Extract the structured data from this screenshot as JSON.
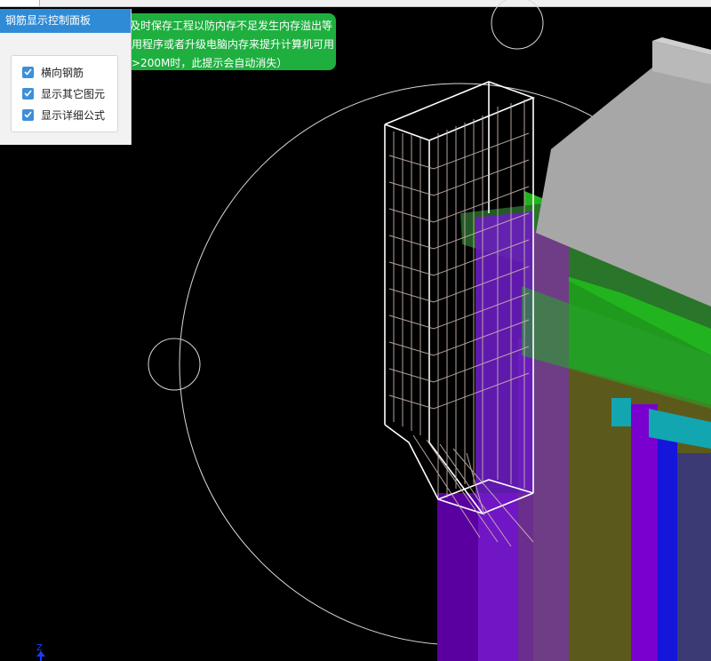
{
  "panel": {
    "title": "钢筋显示控制面板",
    "options": [
      {
        "label": "横向钢筋",
        "checked": true
      },
      {
        "label": "显示其它图元",
        "checked": true
      },
      {
        "label": "显示详细公式",
        "checked": true
      }
    ]
  },
  "toast": {
    "line1": "及时保存工程以防内存不足发生内存溢出等",
    "line2": "用程序或者升级电脑内存来提升计算机可用",
    "line3": ">200M时，此提示会自动消失）"
  },
  "axis": {
    "label": "Z"
  },
  "colors": {
    "panel_header": "#2f8bd6",
    "toast_bg": "#1eaf3f",
    "checkbox": "#3d8fd8",
    "canvas_bg": "#000000"
  }
}
